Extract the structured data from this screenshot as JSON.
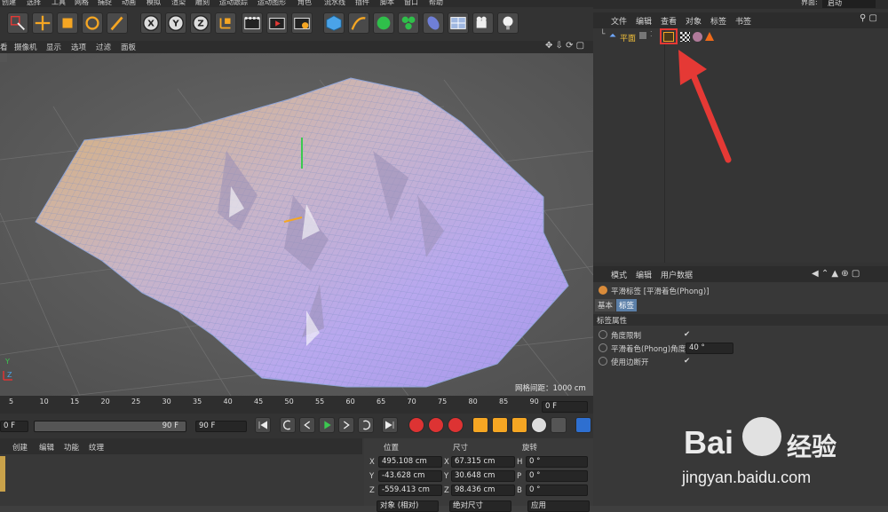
{
  "main_menu": {
    "items": [
      "创建",
      "选择",
      "工具",
      "网格",
      "捕捉",
      "动画",
      "模拟",
      "渲染",
      "雕刻",
      "运动跟踪",
      "运动图形",
      "角色",
      "流水线",
      "插件",
      "脚本",
      "窗口",
      "帮助"
    ]
  },
  "viewport_menu": {
    "items": [
      "看",
      "摄像机",
      "显示",
      "选项",
      "过滤",
      "面板"
    ]
  },
  "viewport": {
    "grid_info": "网格间距：1000 cm",
    "axis_y": "Y",
    "axis_z": "Z"
  },
  "layout_label": "界面:",
  "layout_value": "启动",
  "object_manager": {
    "menu": [
      "文件",
      "编辑",
      "查看",
      "对象",
      "标签",
      "书签"
    ],
    "object_name": "平面",
    "icons": [
      "layer-toggle-icon",
      "phong-tag-icon",
      "checker-tag-icon",
      "material-tag-icon",
      "warning-tag-icon"
    ]
  },
  "attribute_manager": {
    "menu": [
      "模式",
      "编辑",
      "用户数据"
    ],
    "title": "平滑标签 [平滑着色(Phong)]",
    "tabs": [
      "基本",
      "标签"
    ],
    "section": "标签属性",
    "properties": [
      {
        "label": "角度限制",
        "value": "✔",
        "type": "check"
      },
      {
        "label": "平滑着色(Phong)角度",
        "value": "40 °",
        "type": "number"
      },
      {
        "label": "使用边断开",
        "value": "✔",
        "type": "check"
      }
    ]
  },
  "timeline": {
    "ticks": [
      "5",
      "10",
      "15",
      "20",
      "25",
      "30",
      "35",
      "40",
      "45",
      "50",
      "55",
      "60",
      "65",
      "70",
      "75",
      "80",
      "85",
      "90"
    ],
    "current_frame": "0 F"
  },
  "transport": {
    "start_frame": "0 F",
    "end_frame_bar": "90 F",
    "end_frame": "90 F"
  },
  "materials": {
    "menu": [
      "创建",
      "编辑",
      "功能",
      "纹理"
    ]
  },
  "coordinates": {
    "headers": [
      "位置",
      "尺寸",
      "旋转"
    ],
    "rows": [
      {
        "axis": "X",
        "position": "495.108 cm",
        "size_axis": "X",
        "size": "67.315 cm",
        "rot_axis": "H",
        "rotation": "0 °"
      },
      {
        "axis": "Y",
        "position": "-43.628 cm",
        "size_axis": "Y",
        "size": "30.648 cm",
        "rot_axis": "P",
        "rotation": "0 °"
      },
      {
        "axis": "Z",
        "position": "-559.413 cm",
        "size_axis": "Z",
        "size": "98.436 cm",
        "rot_axis": "B",
        "rotation": "0 °"
      }
    ],
    "mode_label": "对象 (相对)",
    "size_mode_label": "绝对尺寸",
    "apply_label": "应用"
  },
  "watermark": {
    "brand": "Bai",
    "brand2": "经验",
    "url": "jingyan.baidu.com"
  },
  "colors": {
    "accent_red": "#e53935",
    "terrain_orange": "#d8b070",
    "terrain_violet": "#b8a8ee"
  }
}
